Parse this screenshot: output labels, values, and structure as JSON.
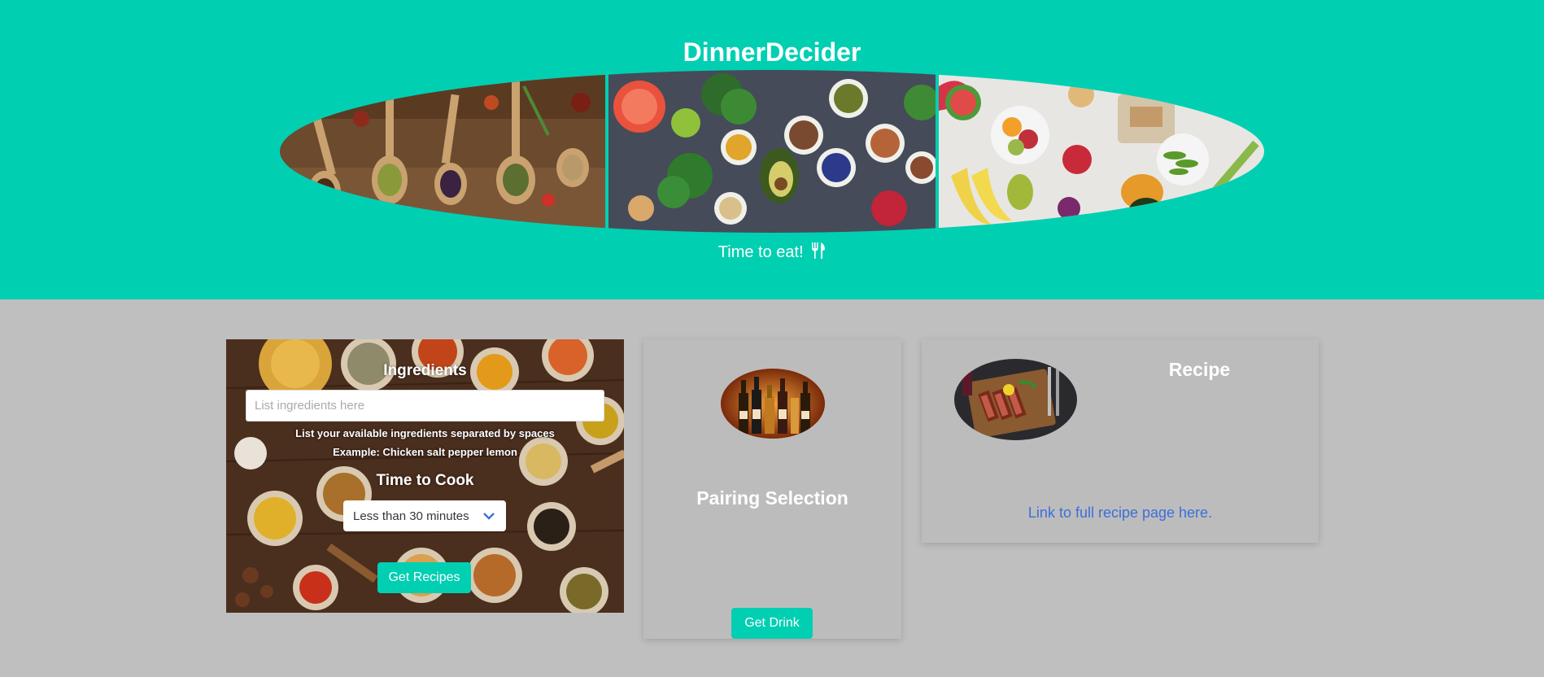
{
  "header": {
    "title": "DinnerDecider",
    "tagline": "Time to eat!",
    "tagline_icon": "fork-knife-icon",
    "colors": {
      "background": "#00cfb2",
      "text": "#ffffff"
    }
  },
  "banner": {
    "images": [
      "spices-on-wooden-spoons",
      "fresh-vegetables-and-grains",
      "fruits-and-vegetables-on-white"
    ]
  },
  "ingredients_card": {
    "title": "Ingredients",
    "input_placeholder": "List ingredients here",
    "input_value": "",
    "help_line1": "List your available ingredients separated by spaces",
    "help_line2": "Example: Chicken salt pepper lemon",
    "time_title": "Time to Cook",
    "time_selected": "Less than 30 minutes",
    "button_label": "Get Recipes",
    "background_image": "spices-background"
  },
  "pairing_card": {
    "image": "wine-bottles",
    "title": "Pairing Selection",
    "button_label": "Get Drink"
  },
  "recipe_card": {
    "image": "steak-on-board",
    "title": "Recipe",
    "link_text": "Link to full recipe page here."
  },
  "colors": {
    "accent": "#00cfb2",
    "page_background": "#c0bfc0",
    "link": "#3b70d6"
  }
}
